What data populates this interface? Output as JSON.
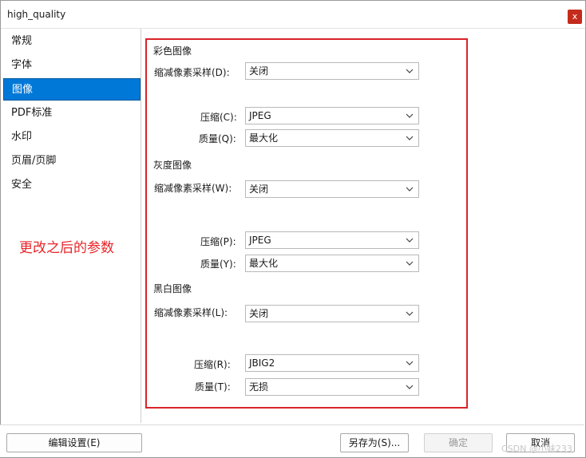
{
  "window": {
    "title": "high_quality",
    "close_label": "x"
  },
  "sidebar": {
    "items": [
      {
        "label": "常规"
      },
      {
        "label": "字体"
      },
      {
        "label": "图像",
        "active": true
      },
      {
        "label": "PDF标准"
      },
      {
        "label": "水印"
      },
      {
        "label": "页眉/页脚"
      },
      {
        "label": "安全"
      }
    ]
  },
  "annotation": "更改之后的参数",
  "color_image": {
    "heading": "彩色图像",
    "downsample_label": "缩减像素采样(D):",
    "downsample_value": "关闭",
    "compress_label": "压缩(C):",
    "compress_value": "JPEG",
    "quality_label": "质量(Q):",
    "quality_value": "最大化"
  },
  "gray_image": {
    "heading": "灰度图像",
    "downsample_label": "缩减像素采样(W):",
    "downsample_value": "关闭",
    "compress_label": "压缩(P):",
    "compress_value": "JPEG",
    "quality_label": "质量(Y):",
    "quality_value": "最大化"
  },
  "mono_image": {
    "heading": "黑白图像",
    "downsample_label": "缩减像素采样(L):",
    "downsample_value": "关闭",
    "compress_label": "压缩(R):",
    "compress_value": "JBIG2",
    "quality_label": "质量(T):",
    "quality_value": "无损"
  },
  "footer": {
    "edit_settings": "编辑设置(E)",
    "save_as": "另存为(S)...",
    "ok": "确定",
    "cancel": "取消"
  },
  "watermark": "CSDN @小妹233",
  "colors": {
    "accent": "#0078d7",
    "annotation_red": "#e8252a",
    "close_red": "#c42b1c"
  }
}
